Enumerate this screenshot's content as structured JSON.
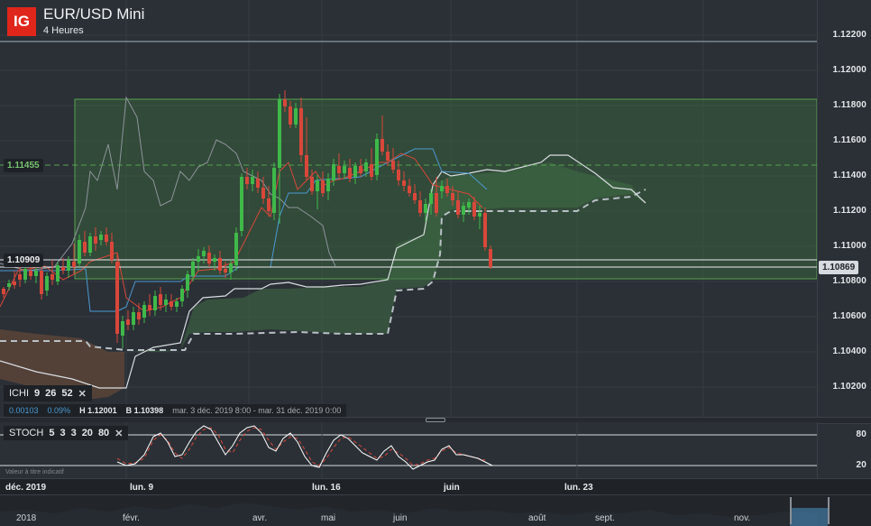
{
  "header": {
    "logo": "IG",
    "title": "EUR/USD Mini",
    "timeframe": "4 Heures"
  },
  "price_axis": {
    "ticks": [
      "1.12200",
      "1.12000",
      "1.11800",
      "1.11600",
      "1.11400",
      "1.11200",
      "1.11000",
      "1.10800",
      "1.10600",
      "1.10400",
      "1.10200"
    ]
  },
  "tags": {
    "level_line": "1.11455",
    "level_line_color": "#3a7a3a",
    "crosshair_price": "1.10909",
    "last_price": "1.10869"
  },
  "ichimoku": {
    "label": "ICHI",
    "p1": "9",
    "p2": "26",
    "p3": "52",
    "close_icon": "close-icon"
  },
  "ohlc": {
    "change": "0.00103",
    "change_pct": "0.09%",
    "high_label": "H",
    "high": "1.12001",
    "low_label": "B",
    "low": "1.10398",
    "range": "mar. 3 déc. 2019 8:00 - mar. 31 déc. 2019 0:00"
  },
  "stoch": {
    "label": "STOCH",
    "p1": "5",
    "p2": "3",
    "p3": "3",
    "p4": "20",
    "p5": "80",
    "upper": "80",
    "lower": "20",
    "note": "Valeur à titre indicatif"
  },
  "date_axis": {
    "ticks": [
      "déc. 2019",
      "lun. 9",
      "lun. 16",
      "juin",
      "lun. 23"
    ]
  },
  "navigator": {
    "ticks": [
      "2018",
      "févr.",
      "avr.",
      "mai",
      "juin",
      "août",
      "sept.",
      "nov."
    ]
  },
  "colors": {
    "up": "#3fb94a",
    "down": "#d9473a",
    "accent": "#e0261b",
    "tenkan": "#d9473a",
    "kijun": "#4a9ad4",
    "chikou": "#8e959c"
  }
}
